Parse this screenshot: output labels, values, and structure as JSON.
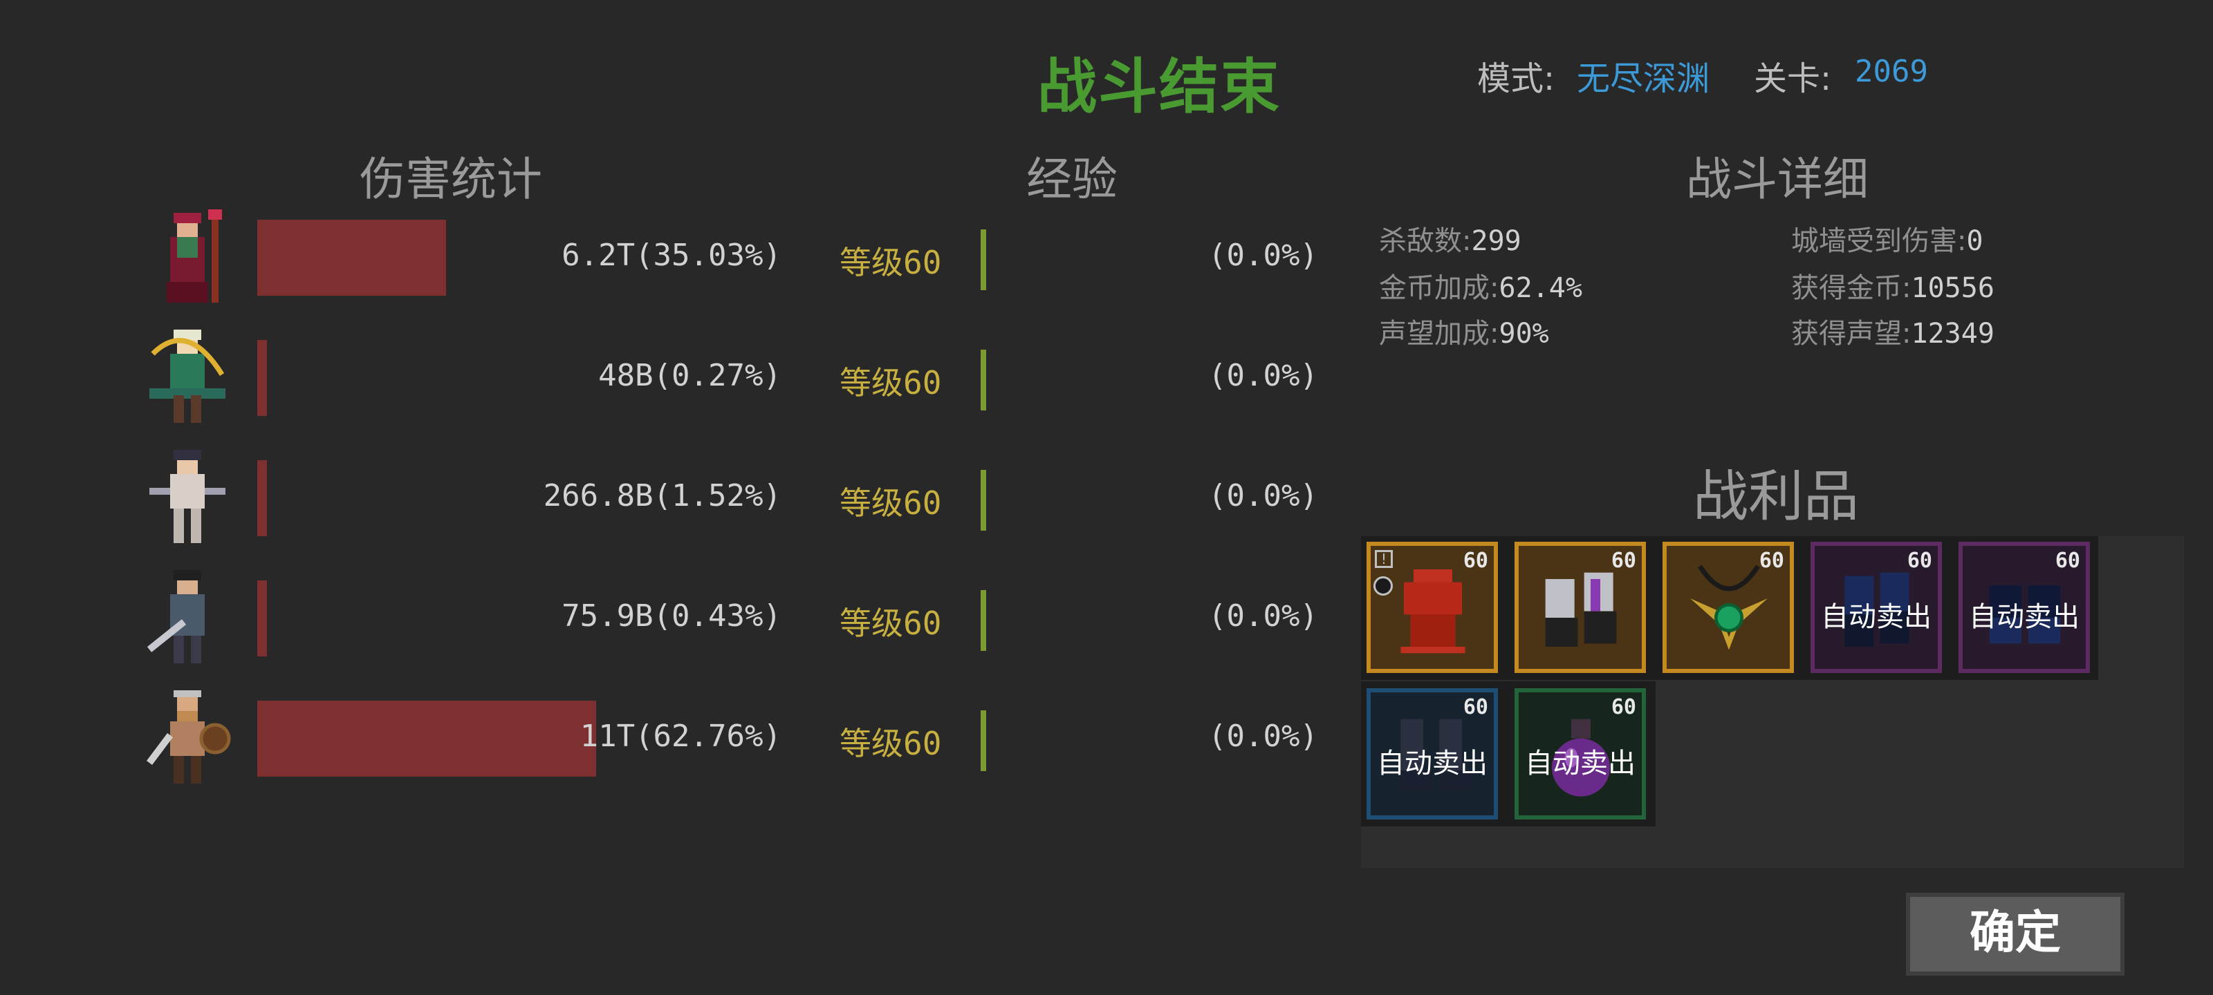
{
  "header": {
    "title": "战斗结束",
    "mode_label": "模式:",
    "mode_value": "无尽深渊",
    "stage_label": "关卡:",
    "stage_value": "2069"
  },
  "sections": {
    "damage": "伤害统计",
    "experience": "经验",
    "details": "战斗详细",
    "loot": "战利品"
  },
  "heroes": [
    {
      "damage": "6.2T(35.03%)",
      "damage_share": 0.3503,
      "level": "等级60",
      "exp": "(0.0%)"
    },
    {
      "damage": "48B(0.27%)",
      "damage_share": 0.0027,
      "level": "等级60",
      "exp": "(0.0%)"
    },
    {
      "damage": "266.8B(1.52%)",
      "damage_share": 0.0152,
      "level": "等级60",
      "exp": "(0.0%)"
    },
    {
      "damage": "75.9B(0.43%)",
      "damage_share": 0.0043,
      "level": "等级60",
      "exp": "(0.0%)"
    },
    {
      "damage": "11T(62.76%)",
      "damage_share": 0.6276,
      "level": "等级60",
      "exp": "(0.0%)"
    }
  ],
  "details": {
    "kills_label": "杀敌数:",
    "kills": "299",
    "gold_bonus_label": "金币加成:",
    "gold_bonus": "62.4%",
    "fame_bonus_label": "声望加成:",
    "fame_bonus": "90%",
    "wall_damage_label": "城墙受到伤害:",
    "wall_damage": "0",
    "gold_gained_label": "获得金币:",
    "gold_gained": "10556",
    "fame_gained_label": "获得声望:",
    "fame_gained": "12349"
  },
  "loot": [
    {
      "level": "60",
      "autosell": "",
      "rarity": "gold",
      "icon": "red-armor-icon"
    },
    {
      "level": "60",
      "autosell": "",
      "rarity": "gold",
      "icon": "gauntlets-icon"
    },
    {
      "level": "60",
      "autosell": "",
      "rarity": "gold",
      "icon": "amulet-icon"
    },
    {
      "level": "60",
      "autosell": "自动卖出",
      "rarity": "purple",
      "icon": "gauntlets-icon"
    },
    {
      "level": "60",
      "autosell": "自动卖出",
      "rarity": "purple",
      "icon": "gauntlets-icon"
    },
    {
      "level": "60",
      "autosell": "自动卖出",
      "rarity": "blue",
      "icon": "boots-icon"
    },
    {
      "level": "60",
      "autosell": "自动卖出",
      "rarity": "green",
      "icon": "potion-icon"
    }
  ],
  "confirm_label": "确定",
  "colors": {
    "title": "#4a9a32",
    "accent_blue": "#3d9ad8",
    "level": "#c7b040",
    "damage_bar": "#7e3030",
    "exp_bar": "#7c9a32"
  }
}
